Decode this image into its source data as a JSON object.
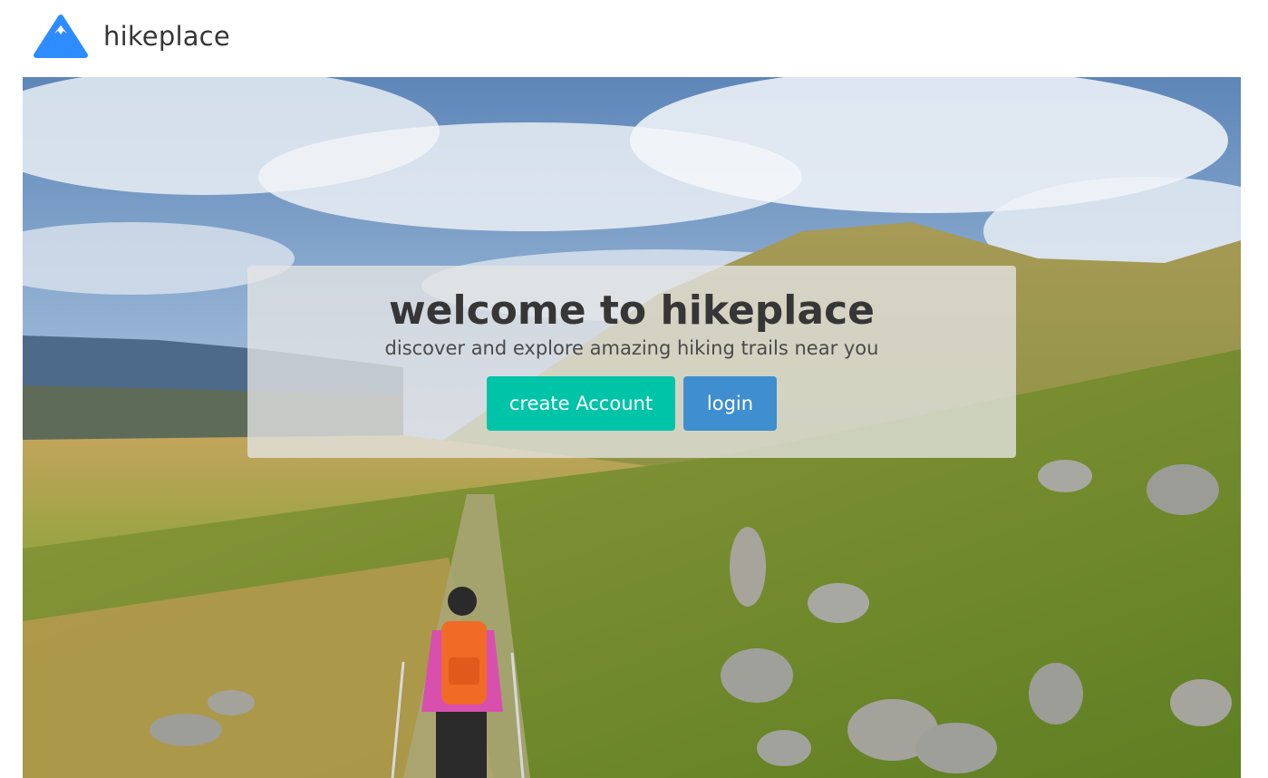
{
  "brand": {
    "name": "hikeplace",
    "logo_icon": "mountain-triangle-icon",
    "logo_color": "#2d8cff"
  },
  "hero": {
    "background": "photo-hiker-on-mountain-trail",
    "title": "welcome to hikeplace",
    "subtitle": "discover and explore amazing hiking trails near you",
    "buttons": {
      "create_account_label": "create Account",
      "login_label": "login"
    }
  },
  "colors": {
    "primary": "#00c4a7",
    "link": "#3e8ed0",
    "text_dark": "#363636"
  }
}
